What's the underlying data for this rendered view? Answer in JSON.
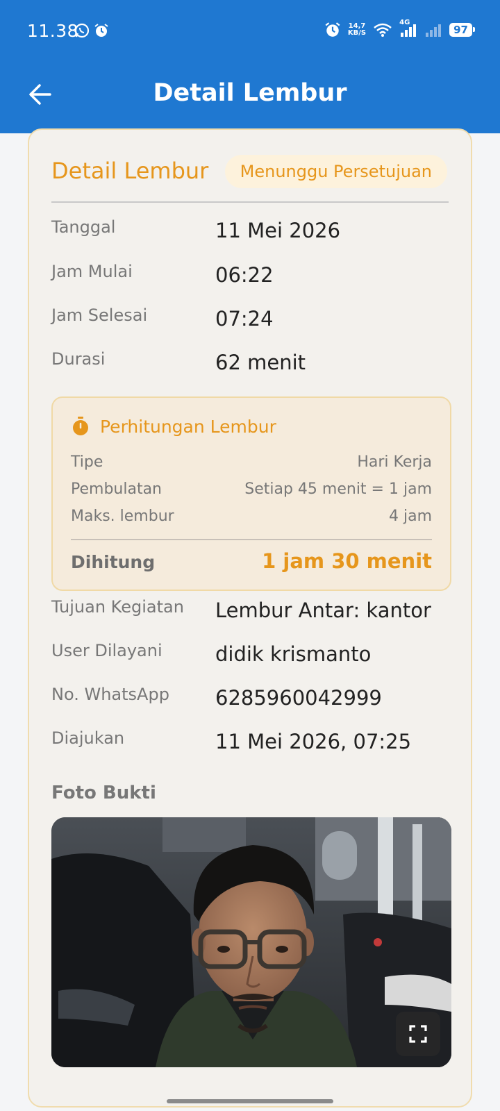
{
  "status_bar": {
    "time": "11.38",
    "speed_value": "14,7",
    "speed_unit": "KB/S",
    "network": "4G",
    "battery": "97"
  },
  "app_bar": {
    "title": "Detail Lembur",
    "back_icon": "arrow-left-icon"
  },
  "card": {
    "title": "Detail Lembur",
    "status_badge": "Menunggu Persetujuan",
    "fields": [
      {
        "label": "Tanggal",
        "value": "11 Mei 2026"
      },
      {
        "label": "Jam Mulai",
        "value": "06:22"
      },
      {
        "label": "Jam Selesai",
        "value": "07:24"
      },
      {
        "label": "Durasi",
        "value": "62 menit"
      }
    ],
    "calculation": {
      "title": "Perhitungan Lembur",
      "icon": "stopwatch-icon",
      "rows": [
        {
          "label": "Tipe",
          "value": "Hari Kerja"
        },
        {
          "label": "Pembulatan",
          "value": "Setiap 45 menit = 1 jam"
        },
        {
          "label": "Maks. lembur",
          "value": "4 jam"
        }
      ],
      "total_label": "Dihitung",
      "total_value": "1 jam 30 menit"
    },
    "details": [
      {
        "label": "Tujuan Kegiatan",
        "value": "Lembur Antar: kantor"
      },
      {
        "label": "User Dilayani",
        "value": "didik krismanto"
      },
      {
        "label": "No. WhatsApp",
        "value": "6285960042999"
      },
      {
        "label": "Diajukan",
        "value": "11 Mei 2026, 07:25"
      }
    ],
    "photo_label": "Foto Bukti",
    "expand_icon": "fullscreen-icon"
  },
  "colors": {
    "primary": "#1f78d1",
    "accent": "#e6961c",
    "card_bg": "#f3f1ed",
    "calc_bg": "#f5ebdc"
  }
}
